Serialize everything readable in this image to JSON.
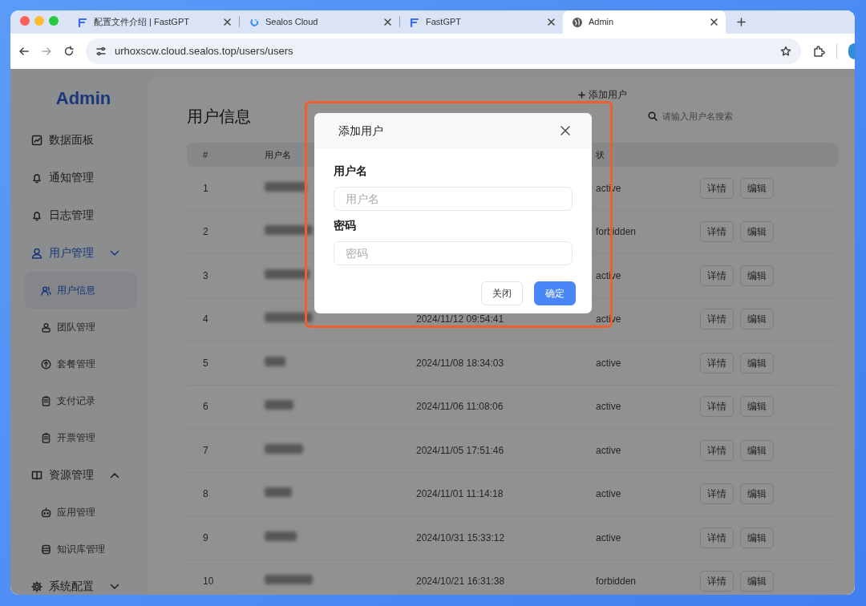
{
  "browser": {
    "tabs": [
      {
        "title": "配置文件介绍 | FastGPT",
        "selected": false
      },
      {
        "title": "Sealos Cloud",
        "selected": false
      },
      {
        "title": "FastGPT",
        "selected": false
      },
      {
        "title": "Admin",
        "selected": true
      }
    ],
    "url": "urhoxscw.cloud.sealos.top/users/users"
  },
  "sidebar": {
    "logo": "Admin",
    "items": [
      {
        "label": "数据面板",
        "selected": false
      },
      {
        "label": "通知管理",
        "selected": false
      },
      {
        "label": "日志管理",
        "selected": false
      },
      {
        "label": "用户管理",
        "selected": false,
        "expanded": true,
        "children": [
          {
            "label": "用户信息",
            "selected": true
          },
          {
            "label": "团队管理",
            "selected": false
          },
          {
            "label": "套餐管理",
            "selected": false
          },
          {
            "label": "支付记录",
            "selected": false
          },
          {
            "label": "开票管理",
            "selected": false
          }
        ]
      },
      {
        "label": "资源管理",
        "selected": false,
        "expanded": true,
        "children": [
          {
            "label": "应用管理",
            "selected": false
          },
          {
            "label": "知识库管理",
            "selected": false
          }
        ]
      },
      {
        "label": "系统配置",
        "selected": false,
        "expanded": false
      }
    ]
  },
  "page": {
    "title": "用户信息",
    "add_button": "添加用户",
    "search": {
      "placeholder": "请输入用户名搜索"
    }
  },
  "table": {
    "header": {
      "index": "#",
      "username": "用户名",
      "status": "状"
    },
    "rows": [
      {
        "index": "1",
        "status": "active",
        "actions": [
          "详情",
          "编辑"
        ]
      },
      {
        "index": "2",
        "status": "forbidden",
        "actions": [
          "详情",
          "编辑"
        ]
      },
      {
        "index": "3",
        "status": "active",
        "actions": [
          "详情",
          "编辑"
        ]
      },
      {
        "index": "4",
        "date": "2024/11/12 09:54:41",
        "status": "active",
        "actions": [
          "详情",
          "编辑"
        ]
      },
      {
        "index": "5",
        "date": "2024/11/08 18:34:03",
        "status": "active",
        "actions": [
          "详情",
          "编辑"
        ]
      },
      {
        "index": "6",
        "date": "2024/11/06 11:08:06",
        "status": "active",
        "actions": [
          "详情",
          "编辑"
        ]
      },
      {
        "index": "7",
        "date": "2024/11/05 17:51:46",
        "status": "active",
        "actions": [
          "详情",
          "编辑"
        ]
      },
      {
        "index": "8",
        "date": "2024/11/01 11:14:18",
        "status": "active",
        "actions": [
          "详情",
          "编辑"
        ]
      },
      {
        "index": "9",
        "date": "2024/10/31 15:33:12",
        "status": "active",
        "actions": [
          "详情",
          "编辑"
        ]
      },
      {
        "index": "10",
        "date": "2024/10/21 16:31:38",
        "status": "forbidden",
        "actions": [
          "详情",
          "编辑"
        ]
      }
    ]
  },
  "modal": {
    "title": "添加用户",
    "fields": [
      {
        "label": "用户名",
        "placeholder": "用户名"
      },
      {
        "label": "密码",
        "placeholder": "密码"
      }
    ],
    "buttons": [
      {
        "label": "关闭",
        "kind": "secondary"
      },
      {
        "label": "确定",
        "kind": "primary"
      }
    ]
  }
}
